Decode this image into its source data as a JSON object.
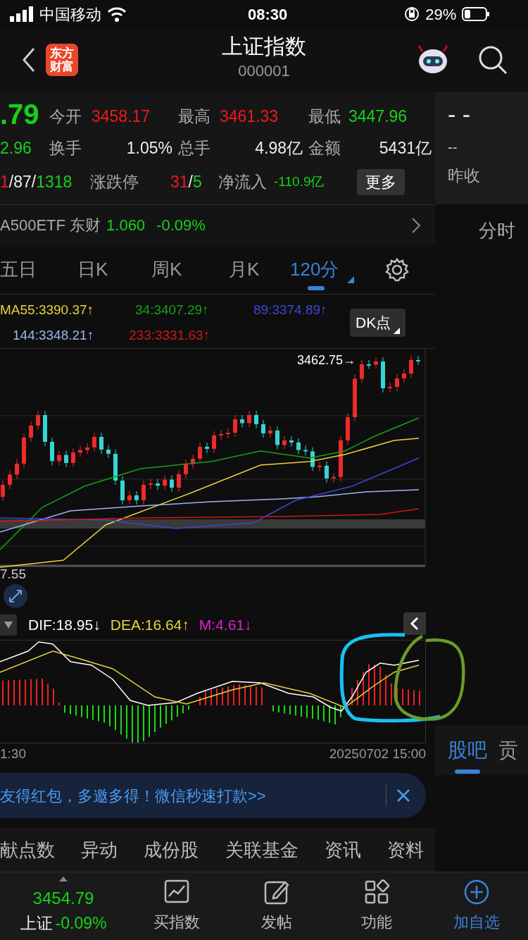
{
  "status_bar": {
    "carrier": "中国移动",
    "time": "08:30",
    "battery": "29%"
  },
  "header": {
    "logo_lines": [
      "东方",
      "财富"
    ],
    "title": "上证指数",
    "code": "000001"
  },
  "quote": {
    "price": {
      "text": ".79",
      "color": "#15d21a"
    },
    "change": {
      "text": "2.96",
      "color": "#15d21a"
    },
    "stats": [
      {
        "label": "今开",
        "value": "3458.17",
        "color": "#f0191e"
      },
      {
        "label": "最高",
        "value": "3461.33",
        "color": "#f0191e"
      },
      {
        "label": "最低",
        "value": "3447.96",
        "color": "#15d21a"
      },
      {
        "label": "换手",
        "value": "1.05%",
        "color": "#eeeeee"
      },
      {
        "label": "总手",
        "value": "4.98亿",
        "color": "#eeeeee"
      },
      {
        "label": "金额",
        "value": "5431亿",
        "color": "#eeeeee"
      }
    ],
    "breadth": [
      {
        "text": "1",
        "color": "#f0191e"
      },
      {
        "text": "/87/",
        "color": "#eeeeee"
      },
      {
        "text": "1318",
        "color": "#15d21a"
      }
    ],
    "limit_label": "涨跌停",
    "limit": [
      {
        "text": "31",
        "color": "#f0191e"
      },
      {
        "text": "/",
        "color": "#eeeeee"
      },
      {
        "text": "5",
        "color": "#15d21a"
      }
    ],
    "netflow_label": "净流入",
    "netflow": "-110.9亿",
    "more_button": "更多"
  },
  "side": {
    "main": "- -",
    "sub": "--",
    "label": "昨收",
    "time_tab": "分时",
    "tabs": [
      {
        "label": "股吧",
        "selected": true
      },
      {
        "label": "贡",
        "selected": false
      }
    ]
  },
  "etf": {
    "name": "A500ETF 东财",
    "price": "1.060",
    "change": "-0.09%"
  },
  "period_tabs": [
    {
      "label": "五日",
      "selected": false
    },
    {
      "label": "日K",
      "selected": false
    },
    {
      "label": "周K",
      "selected": false
    },
    {
      "label": "月K",
      "selected": false
    },
    {
      "label": "120分",
      "selected": true
    }
  ],
  "ma_legend": [
    {
      "text": "MA55:3390.37↑",
      "color": "#e8d23c"
    },
    {
      "text": "34:3407.29↑",
      "color": "#16a01a"
    },
    {
      "text": "89:3374.89↑",
      "color": "#3c46d8"
    },
    {
      "text": "144:3348.21↑",
      "color": "#9fb4f0"
    },
    {
      "text": "233:3331.63↑",
      "color": "#d01818"
    }
  ],
  "kline": {
    "high_label": "3462.75→",
    "low_label": "7.55",
    "dk_button": "DK点"
  },
  "macd": [
    {
      "text": "DIF:18.95↓",
      "color": "#ffffff"
    },
    {
      "text": "DEA:16.64↑",
      "color": "#e8d23c"
    },
    {
      "text": "M:4.61↓",
      "color": "#e020d8"
    }
  ],
  "axis": {
    "start": "1:30",
    "end": "20250702 15:00"
  },
  "banner": {
    "text": "友得红包，多邀多得！微信秒速打款>>"
  },
  "bottom_tabs": [
    {
      "label": "献点数"
    },
    {
      "label": "异动"
    },
    {
      "label": "成份股"
    },
    {
      "label": "关联基金"
    },
    {
      "label": "资讯"
    },
    {
      "label": "资料"
    }
  ],
  "bottom_nav": {
    "index_value": {
      "text": "3454.79",
      "color": "#15d21a"
    },
    "index_name": "上证",
    "index_change": {
      "text": "-0.09%",
      "color": "#15d21a"
    },
    "items": [
      {
        "label": "买指数",
        "kind": "chart",
        "selected": false
      },
      {
        "label": "发帖",
        "kind": "edit",
        "selected": false
      },
      {
        "label": "功能",
        "kind": "grid",
        "selected": false
      },
      {
        "label": "加自选",
        "kind": "add",
        "selected": true
      }
    ]
  }
}
